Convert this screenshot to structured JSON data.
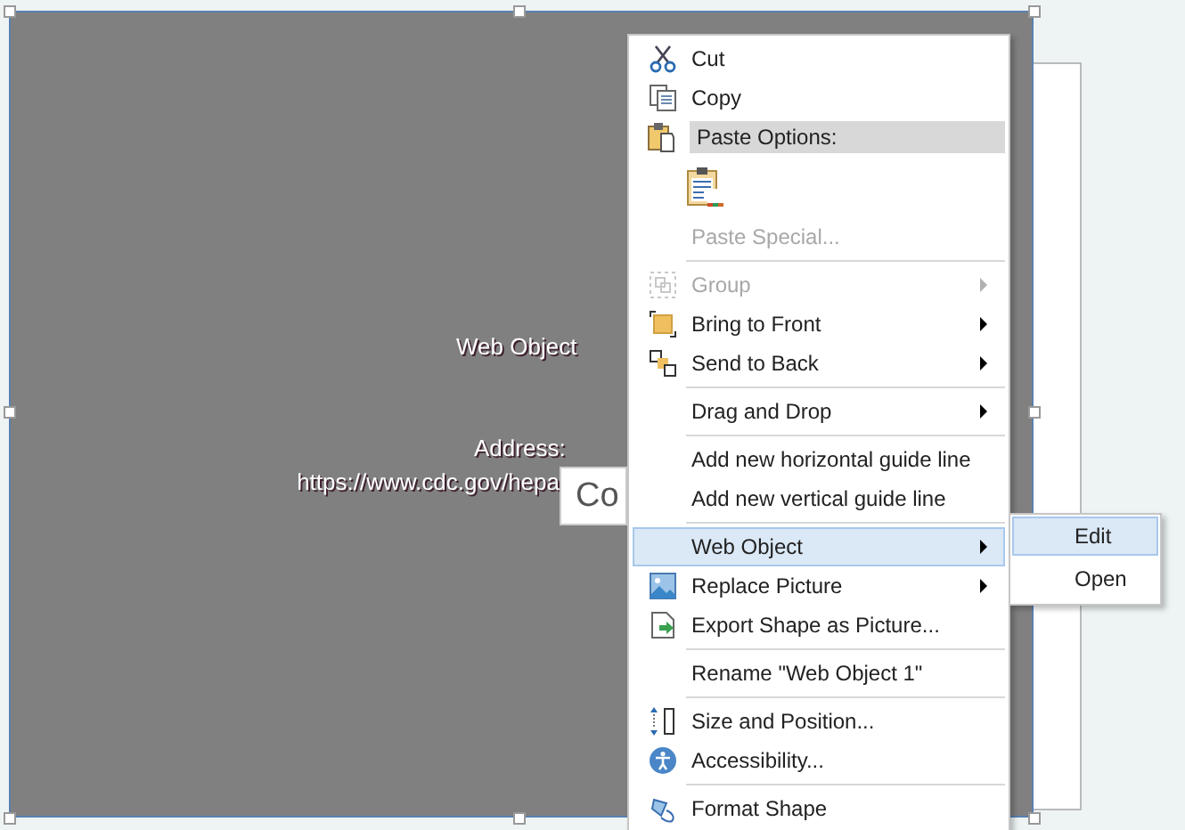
{
  "shape": {
    "title": "Web Object",
    "address_label": "Address:",
    "address": "https://www.cdc.gov/hepa"
  },
  "tooltip": {
    "text": "Co"
  },
  "context_menu": [
    {
      "kind": "item",
      "label": "Cut",
      "disabled": false,
      "submenu": false,
      "selected": false
    },
    {
      "kind": "item",
      "label": "Copy",
      "disabled": false,
      "submenu": false,
      "selected": false
    },
    {
      "kind": "header",
      "label": "Paste Options:"
    },
    {
      "kind": "paste-icons"
    },
    {
      "kind": "item",
      "label": "Paste Special...",
      "disabled": true,
      "submenu": false,
      "selected": false
    },
    {
      "kind": "separator"
    },
    {
      "kind": "item",
      "label": "Group",
      "disabled": true,
      "submenu": true,
      "selected": false
    },
    {
      "kind": "item",
      "label": "Bring to Front",
      "disabled": false,
      "submenu": true,
      "selected": false
    },
    {
      "kind": "item",
      "label": "Send to Back",
      "disabled": false,
      "submenu": true,
      "selected": false
    },
    {
      "kind": "separator"
    },
    {
      "kind": "item",
      "label": "Drag and Drop",
      "disabled": false,
      "submenu": true,
      "selected": false
    },
    {
      "kind": "separator"
    },
    {
      "kind": "item",
      "label": "Add new horizontal guide line",
      "disabled": false,
      "submenu": false,
      "selected": false
    },
    {
      "kind": "item",
      "label": "Add new vertical guide line",
      "disabled": false,
      "submenu": false,
      "selected": false
    },
    {
      "kind": "separator"
    },
    {
      "kind": "item",
      "label": "Web Object",
      "disabled": false,
      "submenu": true,
      "selected": true
    },
    {
      "kind": "item",
      "label": "Replace Picture",
      "disabled": false,
      "submenu": true,
      "selected": false
    },
    {
      "kind": "item",
      "label": "Export Shape as Picture...",
      "disabled": false,
      "submenu": false,
      "selected": false
    },
    {
      "kind": "separator"
    },
    {
      "kind": "item",
      "label": "Rename \"Web Object 1\"",
      "disabled": false,
      "submenu": false,
      "selected": false
    },
    {
      "kind": "separator"
    },
    {
      "kind": "item",
      "label": "Size and Position...",
      "disabled": false,
      "submenu": false,
      "selected": false
    },
    {
      "kind": "item",
      "label": "Accessibility...",
      "disabled": false,
      "submenu": false,
      "selected": false
    },
    {
      "kind": "separator"
    },
    {
      "kind": "item",
      "label": "Format Shape",
      "disabled": false,
      "submenu": false,
      "selected": false
    }
  ],
  "submenu": [
    {
      "label": "Edit",
      "selected": true
    },
    {
      "label": "Open",
      "selected": false
    }
  ]
}
